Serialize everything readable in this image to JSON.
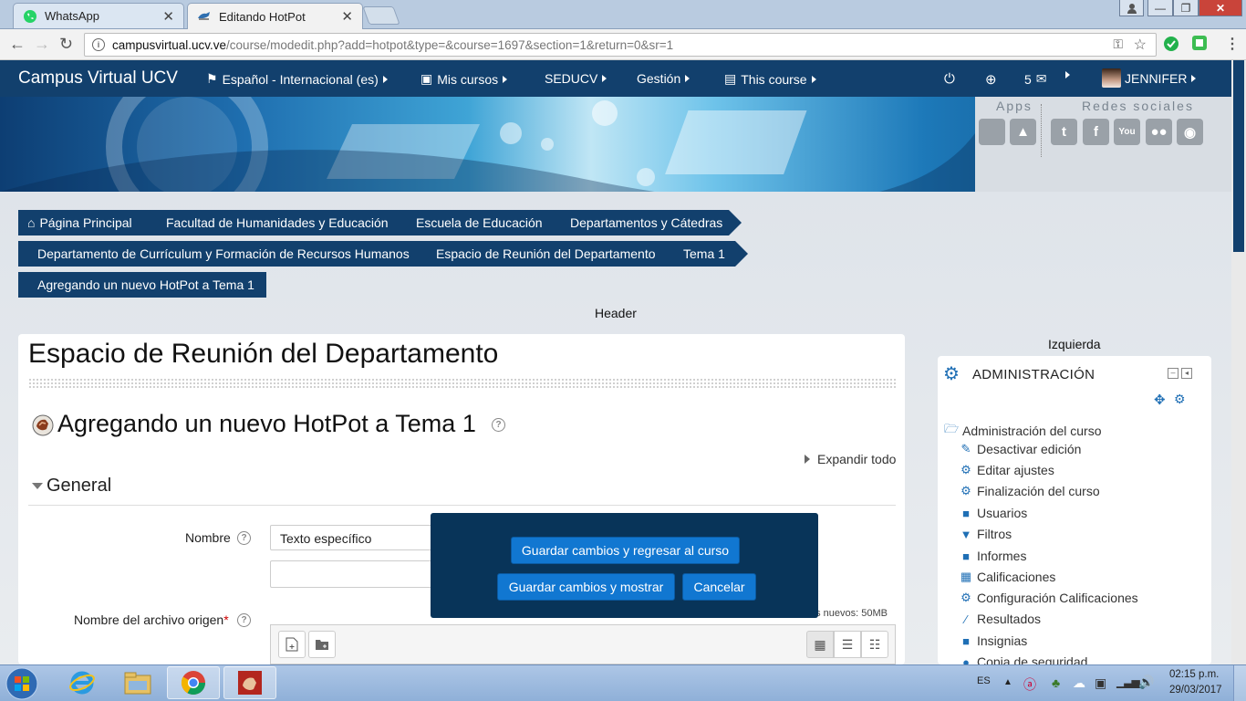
{
  "browser": {
    "tabs": [
      {
        "title": "WhatsApp",
        "icon": "whatsapp-icon"
      },
      {
        "title": "Editando HotPot",
        "icon": "moodle-icon"
      }
    ],
    "url_host": "campusvirtual.ucv.ve",
    "url_path": "/course/modedit.php?add=hotpot&type=&course=1697&section=1&return=0&sr=1"
  },
  "navbar": {
    "brand": "Campus Virtual UCV",
    "language": "Español - Internacional (es)",
    "my_courses": "Mis cursos",
    "seducv": "SEDUCV",
    "gestion": "Gestión",
    "this_course": "This course",
    "messages_count": "5",
    "user": "JENNIFER"
  },
  "banner": {
    "apps_label": "Apps",
    "social_label": "Redes sociales"
  },
  "breadcrumb": [
    "Página Principal",
    "Facultad de Humanidades y Educación",
    "Escuela de Educación",
    "Departamentos y Cátedras",
    "Departamento de Currículum y Formación de Recursos Humanos",
    "Espacio de Reunión del Departamento",
    "Tema 1",
    "Agregando un nuevo HotPot a Tema 1"
  ],
  "region_labels": {
    "header": "Header",
    "left": "Izquierda"
  },
  "main": {
    "page_title": "Espacio de Reunión del Departamento",
    "form_title": "Agregando un nuevo HotPot a Tema 1",
    "expand_all": "Expandir todo",
    "section_general": "General",
    "name_label": "Nombre",
    "name_value": "Texto específico",
    "source_file_label": "Nombre del archivo origen",
    "required_mark": "*",
    "max_size_text": "os nuevos: 50MB"
  },
  "popup": {
    "save_return": "Guardar cambios y regresar al curso",
    "save_show": "Guardar cambios y mostrar",
    "cancel": "Cancelar"
  },
  "admin_block": {
    "title": "ADMINISTRACIÓN",
    "items": [
      "Administración del curso",
      "Desactivar edición",
      "Editar ajustes",
      "Finalización del curso",
      "Usuarios",
      "Filtros",
      "Informes",
      "Calificaciones",
      "Configuración Calificaciones",
      "Resultados",
      "Insignias",
      "Copia de seguridad"
    ]
  },
  "taskbar": {
    "lang": "ES",
    "time": "02:15 p.m.",
    "date": "29/03/2017"
  },
  "colors": {
    "navbar": "#12406d",
    "button": "#1177d1",
    "popup": "#083459"
  }
}
